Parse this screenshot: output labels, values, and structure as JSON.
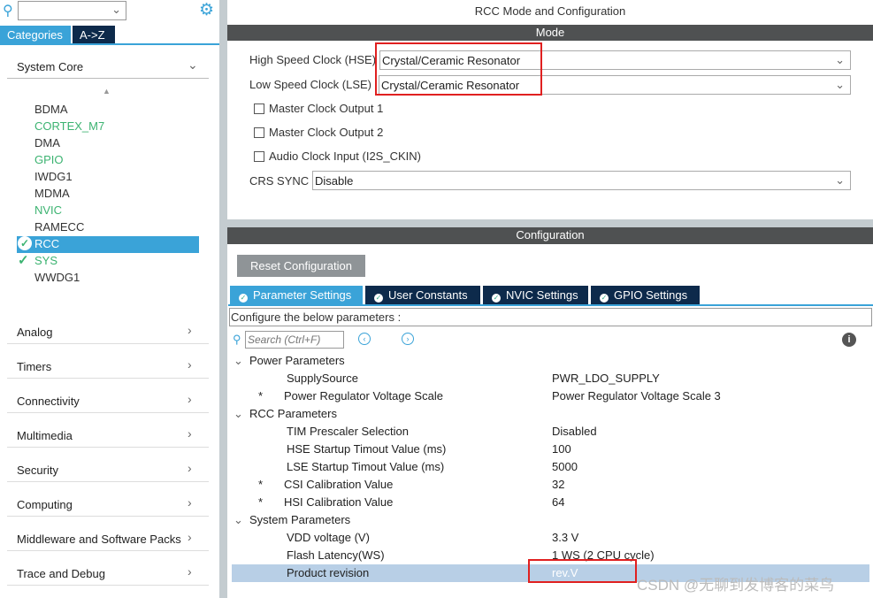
{
  "left": {
    "search_value": "",
    "tabs": [
      "Categories",
      "A->Z"
    ],
    "section": "System Core",
    "items": [
      {
        "label": "BDMA",
        "status": "none"
      },
      {
        "label": "CORTEX_M7",
        "status": "green"
      },
      {
        "label": "DMA",
        "status": "none"
      },
      {
        "label": "GPIO",
        "status": "green"
      },
      {
        "label": "IWDG1",
        "status": "none"
      },
      {
        "label": "MDMA",
        "status": "none"
      },
      {
        "label": "NVIC",
        "status": "green"
      },
      {
        "label": "RAMECC",
        "status": "none"
      },
      {
        "label": "RCC",
        "status": "selected-check"
      },
      {
        "label": "SYS",
        "status": "check"
      },
      {
        "label": "WWDG1",
        "status": "none"
      }
    ],
    "categories": [
      "Analog",
      "Timers",
      "Connectivity",
      "Multimedia",
      "Security",
      "Computing",
      "Middleware and Software Packs",
      "Trace and Debug"
    ]
  },
  "main": {
    "title": "RCC Mode and Configuration",
    "mode": {
      "header": "Mode",
      "hse_label": "High Speed Clock (HSE)",
      "hse_value": "Crystal/Ceramic Resonator",
      "lse_label": "Low Speed Clock (LSE)",
      "lse_value": "Crystal/Ceramic Resonator",
      "checkboxes": [
        "Master Clock Output 1",
        "Master Clock Output 2",
        "Audio Clock Input (I2S_CKIN)"
      ],
      "crs_label": "CRS SYNC",
      "crs_value": "Disable"
    },
    "config": {
      "header": "Configuration",
      "reset_label": "Reset Configuration",
      "tabs": [
        "Parameter Settings",
        "User Constants",
        "NVIC Settings",
        "GPIO Settings"
      ],
      "hint": "Configure the below parameters :",
      "search_placeholder": "Search (Ctrl+F)",
      "rows": [
        {
          "type": "group",
          "name": "Power Parameters"
        },
        {
          "name": "SupplySource",
          "value": "PWR_LDO_SUPPLY",
          "star": ""
        },
        {
          "name": "Power Regulator Voltage Scale",
          "value": "Power Regulator Voltage Scale 3",
          "star": "*"
        },
        {
          "type": "group",
          "name": "RCC Parameters"
        },
        {
          "name": "TIM Prescaler Selection",
          "value": "Disabled",
          "star": ""
        },
        {
          "name": "HSE Startup Timout Value (ms)",
          "value": "100",
          "star": ""
        },
        {
          "name": "LSE Startup Timout Value (ms)",
          "value": "5000",
          "star": ""
        },
        {
          "name": "CSI Calibration Value",
          "value": "32",
          "star": "*"
        },
        {
          "name": "HSI Calibration Value",
          "value": "64",
          "star": "*"
        },
        {
          "type": "group",
          "name": "System Parameters"
        },
        {
          "name": "VDD voltage (V)",
          "value": "3.3 V",
          "star": ""
        },
        {
          "name": "Flash Latency(WS)",
          "value": "1 WS (2 CPU cycle)",
          "star": ""
        },
        {
          "name": "Product revision",
          "value": "rev.V",
          "star": "",
          "selected": true
        }
      ]
    }
  },
  "watermark": "CSDN @无聊到发博客的菜鸟"
}
